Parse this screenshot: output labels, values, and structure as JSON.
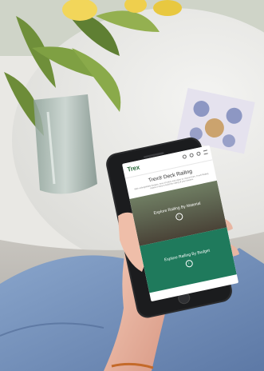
{
  "phone_screen": {
    "logo": "Trex",
    "header_icons": [
      "search-icon",
      "user-icon",
      "cart-icon",
      "menu-icon"
    ],
    "title": "Trex® Deck Railing",
    "description": "With unforgettable designs, tons of colors and styles to choose from, Trex® Railing makes it easy to build the railing of your dreams.",
    "tiles": [
      {
        "label": "Explore Railing By Material",
        "icon": "chevron-down-icon",
        "glyph": "↓"
      },
      {
        "label": "Explore Railing By Budget",
        "icon": "chevron-down-icon",
        "glyph": "↓"
      }
    ]
  },
  "colors": {
    "brand_green": "#1f7a5c",
    "logo_green": "#2d6a3e"
  }
}
